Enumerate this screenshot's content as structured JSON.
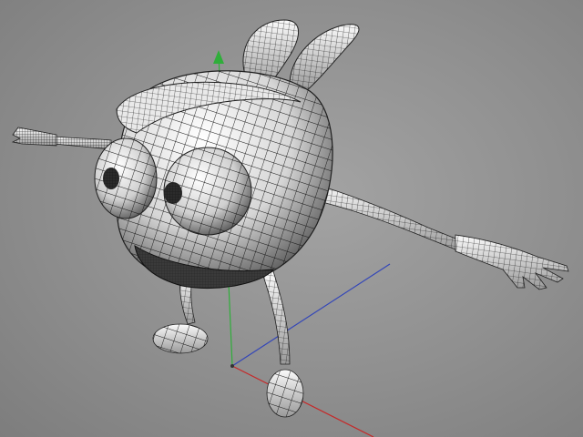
{
  "viewport": {
    "background_color": "#8f8f8f",
    "model": {
      "mesh_fill": "#f1f1f1",
      "mesh_shadow": "#4a4a4a",
      "wire_color": "#141414"
    },
    "axes": {
      "x_color": "#c62828",
      "y_color": "#2fae3a",
      "z_color": "#3346b8"
    }
  }
}
